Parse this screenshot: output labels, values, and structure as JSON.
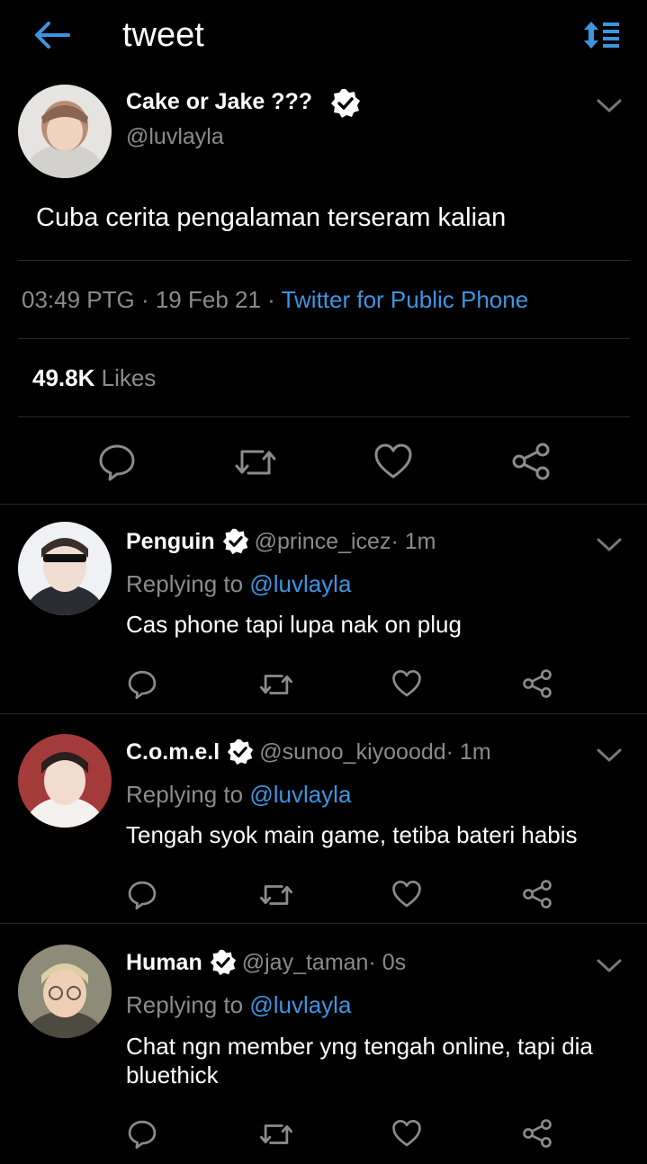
{
  "header": {
    "title": "tweet",
    "back_icon": "arrow-left-icon",
    "sort_icon": "sort-icon",
    "accent": "#3d95e0"
  },
  "tweet": {
    "author_name": "Cake or Jake ???",
    "author_handle": "@luvlayla",
    "text": "Cuba cerita pengalaman terseram kalian",
    "time": "03:49 PTG",
    "sep1": " · ",
    "date": "19 Feb 21",
    "sep2": " · ",
    "source": "Twitter for Public Phone",
    "likes_count": "49.8K",
    "likes_label": " Likes"
  },
  "replies": [
    {
      "name": "Penguin",
      "handle": "@prince_icez",
      "time": " · 1m",
      "replying": "Replying to ",
      "to": "@luvlayla",
      "text": "Cas phone tapi lupa nak on plug"
    },
    {
      "name": "C.o.m.e.l",
      "handle": "@sunoo_kiyooodd",
      "time": " · 1m",
      "replying": "Replying to ",
      "to": "@luvlayla",
      "text": "Tengah syok main game, tetiba bateri habis"
    },
    {
      "name": "Human",
      "handle": "@jay_taman",
      "time": " · 0s",
      "replying": "Replying to ",
      "to": "@luvlayla",
      "text": "Chat ngn member yng tengah online, tapi dia bluethick"
    }
  ]
}
